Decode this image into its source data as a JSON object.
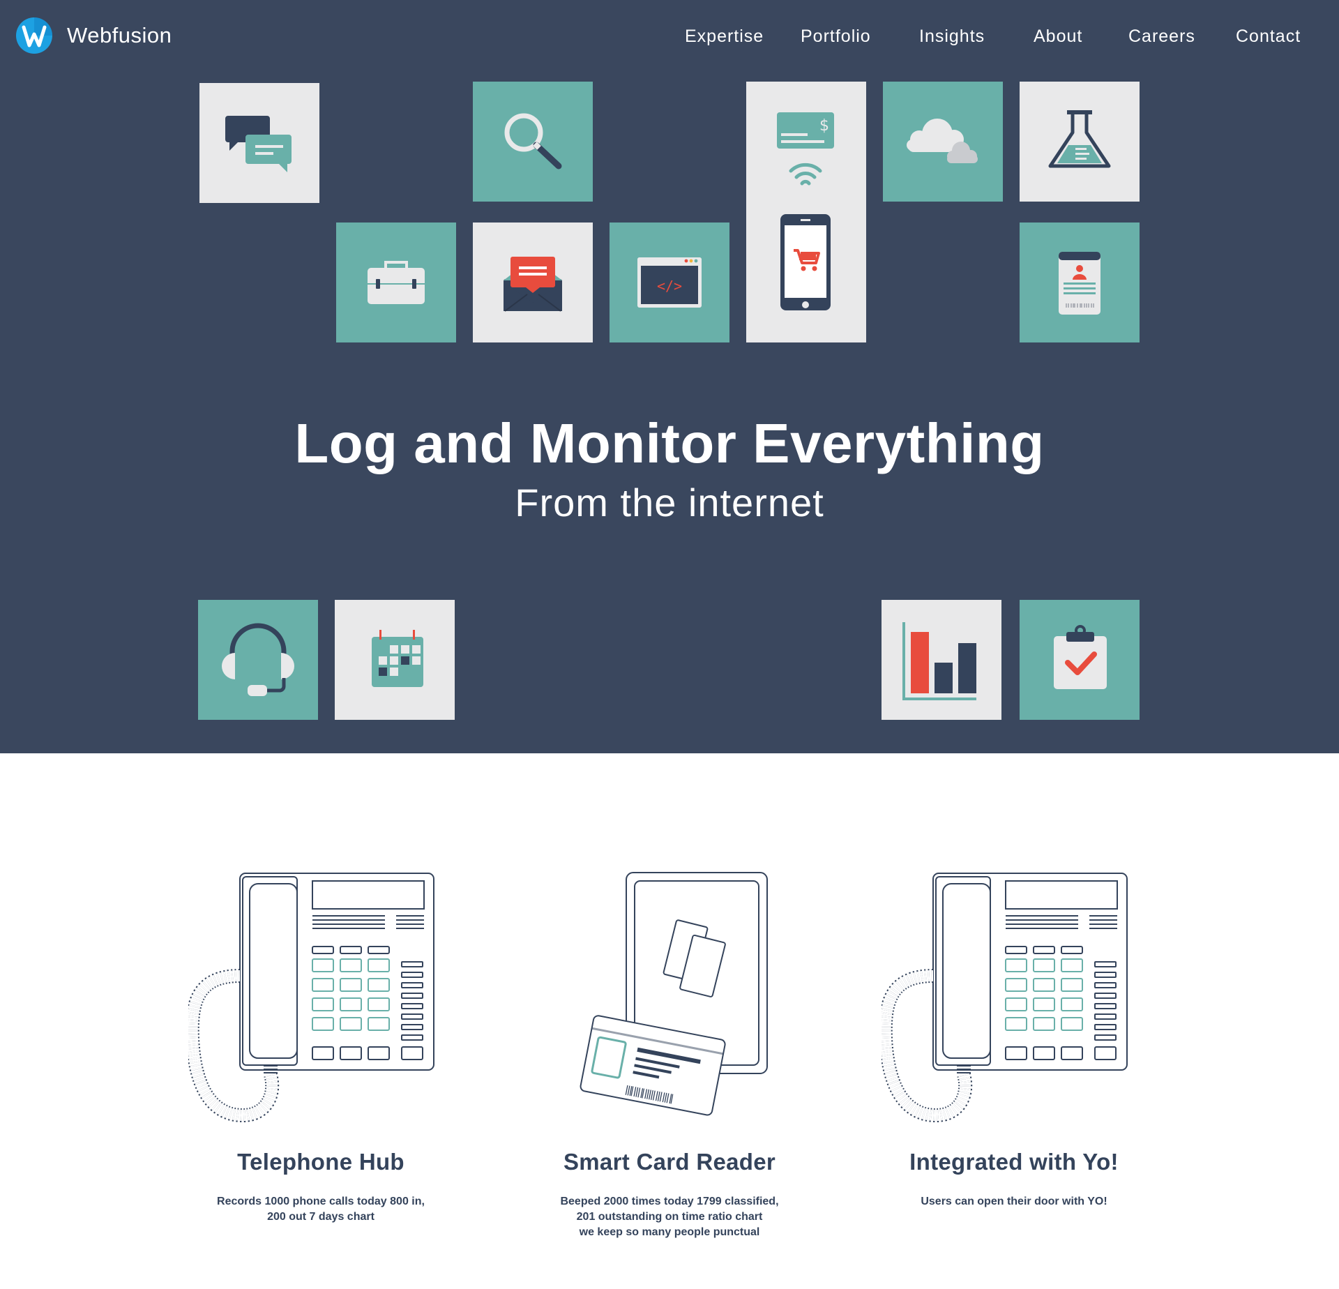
{
  "brand": {
    "name": "Webfusion",
    "logo_icon": "webfusion-w-logo-icon",
    "logo_color": "#1da1e2"
  },
  "nav": {
    "items": [
      {
        "label": "Expertise"
      },
      {
        "label": "Portfolio"
      },
      {
        "label": "Insights"
      },
      {
        "label": "About"
      },
      {
        "label": "Careers"
      },
      {
        "label": "Contact"
      }
    ]
  },
  "hero": {
    "title": "Log and Monitor Everything",
    "subtitle": "From the internet",
    "background": "#3a475e",
    "tile_colors": {
      "light": "#e9e9ea",
      "teal": "#69b0a9"
    },
    "tiles": [
      {
        "icon": "chat-bubbles-icon"
      },
      {
        "icon": "magnifier-icon"
      },
      {
        "icon": "payment-phone-icon"
      },
      {
        "icon": "cloud-icon"
      },
      {
        "icon": "flask-icon"
      },
      {
        "icon": "briefcase-icon"
      },
      {
        "icon": "envelope-icon"
      },
      {
        "icon": "code-window-icon"
      },
      {
        "icon": "id-badge-icon"
      },
      {
        "icon": "headset-icon"
      },
      {
        "icon": "calendar-icon"
      },
      {
        "icon": "bar-chart-icon"
      },
      {
        "icon": "clipboard-check-icon"
      }
    ]
  },
  "features": [
    {
      "title": "Telephone Hub",
      "icon": "desk-telephone-icon",
      "description_lines": [
        "Records 1000 phone calls today 800 in,",
        "200 out 7 days chart"
      ]
    },
    {
      "title": "Smart Card Reader",
      "icon": "smart-card-reader-icon",
      "description_lines": [
        "Beeped 2000 times today 1799 classified,",
        "201 outstanding on time ratio chart",
        "we keep so many people punctual"
      ]
    },
    {
      "title": "Integrated with Yo!",
      "icon": "desk-telephone-icon",
      "description_lines": [
        "Users can open their door with YO!"
      ]
    }
  ],
  "colors": {
    "accent_red": "#e84c3d",
    "navy": "#34435b"
  }
}
